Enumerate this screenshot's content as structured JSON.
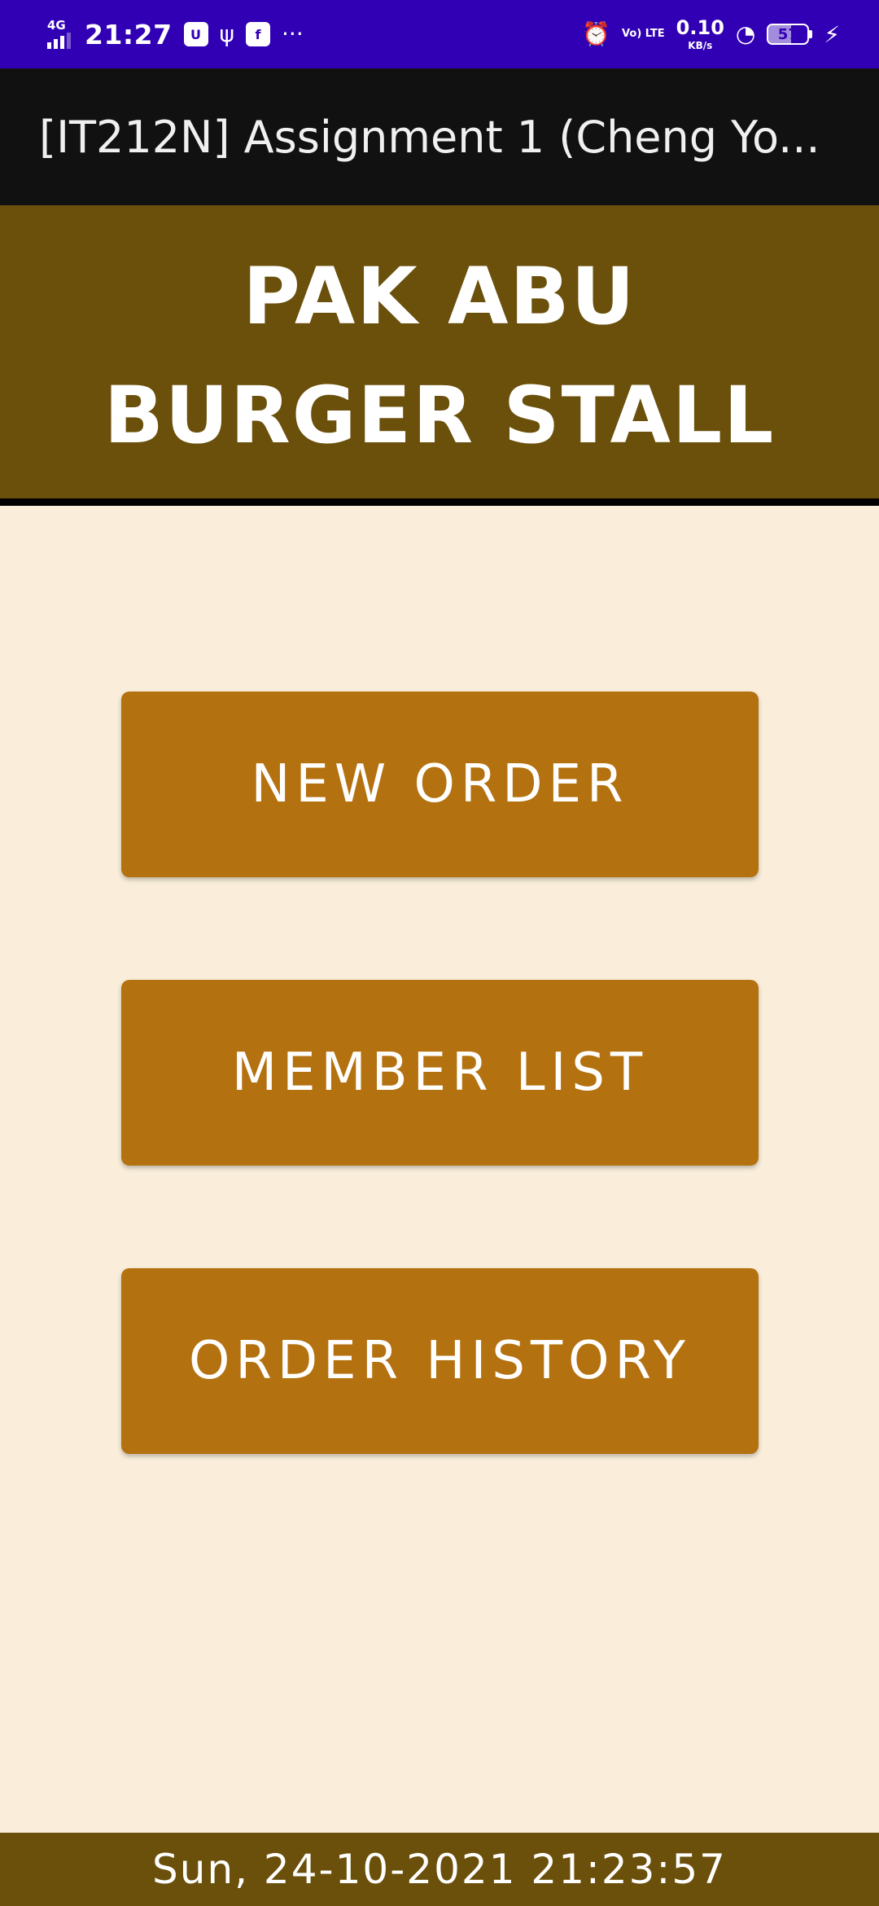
{
  "status_bar": {
    "network": "4G",
    "signal_level": 3,
    "time": "21:27",
    "notification_icons": [
      "usb-debug-icon",
      "usb-icon",
      "facebook-icon",
      "more-notifications-icon"
    ],
    "usb_debug_glyph": "U",
    "usb_glyph": "ψ",
    "facebook_glyph": "f",
    "more_glyph": "···",
    "alarm_glyph": "⏰",
    "volte_label": "Vo) LTE",
    "net_speed": "0.10",
    "net_speed_unit": "KB/s",
    "wifi_glyph": "◔",
    "battery_level": "57",
    "battery_fraction": 0.57,
    "charging_glyph": "⚡",
    "colors": {
      "background": "#3200b4",
      "foreground": "#ffffff"
    }
  },
  "app_bar": {
    "title": "[IT212N] Assignment 1 (Cheng Yo...",
    "background": "#111111"
  },
  "header": {
    "line1": "PAK ABU",
    "line2": "BURGER STALL",
    "background": "#6b500b"
  },
  "menu": {
    "new_order": "NEW ORDER",
    "member_list": "MEMBER LIST",
    "order_history": "ORDER HISTORY",
    "button_color": "#b4710f"
  },
  "footer": {
    "datetime": "Sun, 24-10-2021 21:23:57",
    "background": "#6b500b"
  },
  "page_background": "#faeedb"
}
